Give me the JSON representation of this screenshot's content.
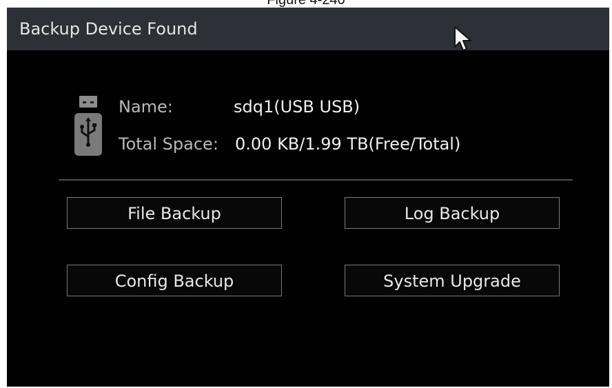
{
  "caption": "Figure 4-240",
  "dialog": {
    "title": "Backup Device Found",
    "device_icon": "usb-drive-icon",
    "name_label": "Name:",
    "name_value": "sdq1(USB USB)",
    "space_label": "Total Space:",
    "space_value": "0.00 KB/1.99 TB(Free/Total)"
  },
  "buttons": {
    "file_backup": "File Backup",
    "log_backup": "Log Backup",
    "config_backup": "Config Backup",
    "system_upgrade": "System Upgrade"
  },
  "colors": {
    "titlebar": "#2d3036",
    "background": "#010101",
    "button_border": "#7a7a7a"
  }
}
